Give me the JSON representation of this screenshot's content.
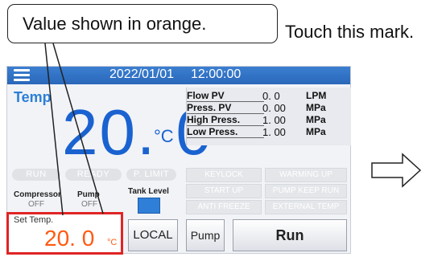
{
  "annotations": {
    "callout_text": "Value shown in orange.",
    "touch_note": "Touch this mark."
  },
  "header": {
    "date": "2022/01/01",
    "time": "12:00:00"
  },
  "temperature": {
    "label": "Temp",
    "value": "20. 0",
    "unit": "°C"
  },
  "pv_panel": [
    {
      "label": "Flow PV",
      "value": "0. 0",
      "unit": "LPM"
    },
    {
      "label": "Press. PV",
      "value": "0. 00",
      "unit": "MPa"
    },
    {
      "label": "High Press.",
      "value": "1. 00",
      "unit": "MPa"
    },
    {
      "label": "Low Press.",
      "value": "1. 00",
      "unit": "MPa"
    }
  ],
  "status_pills": [
    "RUN",
    "READY",
    "P. LIMIT"
  ],
  "status_boxes": [
    "KEYLOCK",
    "WARMING UP",
    "START UP",
    "PUMP KEEP RUN",
    "ANTI FREEZE",
    "EXTERNAL TEMP"
  ],
  "indicators": {
    "compressor_label": "Compressor",
    "compressor_value": "OFF",
    "pump_label": "Pump",
    "pump_value": "OFF",
    "tank_level_label": "Tank Level"
  },
  "set_temp": {
    "label": "Set Temp.",
    "value": "20. 0",
    "unit": "°C"
  },
  "buttons": {
    "local": "LOCAL",
    "pump": "Pump",
    "run": "Run"
  },
  "colors": {
    "header_blue": "#2a67b9",
    "temp_blue": "#1a62d0",
    "set_temp_orange": "#ff5a10",
    "highlight_red": "#e02424",
    "tank_blue": "#2f7ed8"
  },
  "icons": {
    "menu": "hamburger-menu-icon",
    "arrow": "right-arrow-icon"
  }
}
